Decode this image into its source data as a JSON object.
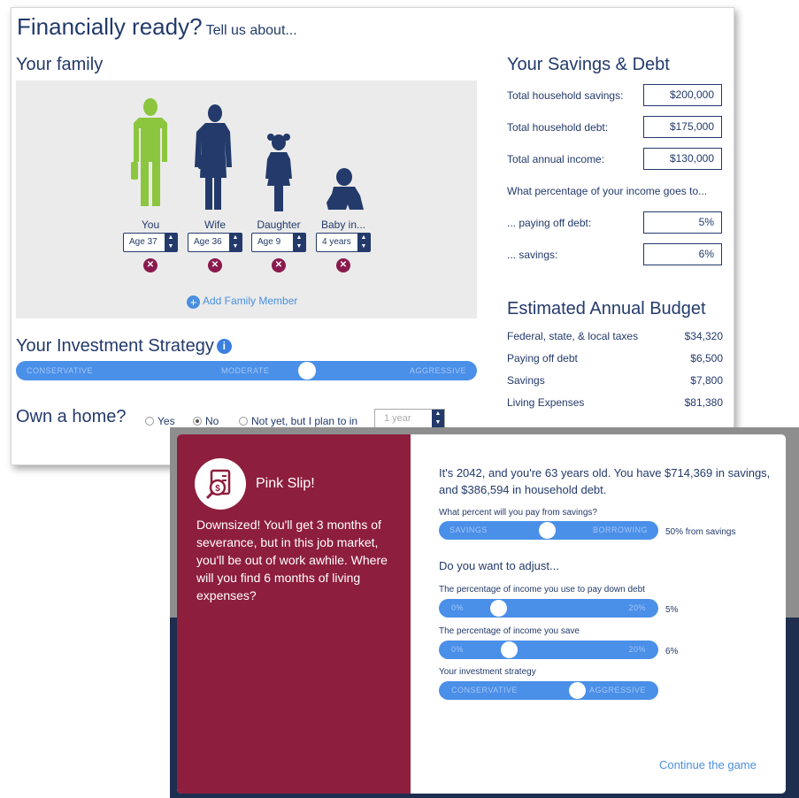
{
  "header": {
    "title": "Financially ready?",
    "subtitle": "Tell us about..."
  },
  "family": {
    "heading": "Your family",
    "members": [
      {
        "name": "You",
        "age": "Age 37",
        "color": "#8cc63f"
      },
      {
        "name": "Wife",
        "age": "Age 36",
        "color": "#233a6b"
      },
      {
        "name": "Daughter",
        "age": "Age 9",
        "color": "#233a6b"
      },
      {
        "name": "Baby in...",
        "age": "4 years",
        "color": "#233a6b"
      }
    ],
    "add_label": "Add Family Member"
  },
  "strategy": {
    "heading": "Your Investment Strategy",
    "labels": [
      "CONSERVATIVE",
      "MODERATE",
      "AGGRESSIVE"
    ],
    "level": 0.64
  },
  "home": {
    "question": "Own a home?",
    "options": [
      "Yes",
      "No",
      "Not yet, but I plan to in"
    ],
    "selected": "No",
    "plan_value": "1 year"
  },
  "savings_debt": {
    "heading": "Your Savings & Debt",
    "rows": [
      {
        "label": "Total household savings:",
        "value": "$200,000"
      },
      {
        "label": "Total household debt:",
        "value": "$175,000"
      },
      {
        "label": "Total annual income:",
        "value": "$130,000"
      }
    ],
    "percent_question": "What percentage of your income goes to...",
    "percent_rows": [
      {
        "label": "... paying off debt:",
        "value": "5%"
      },
      {
        "label": "... savings:",
        "value": "6%"
      }
    ]
  },
  "budget": {
    "heading": "Estimated Annual Budget",
    "rows": [
      {
        "label": "Federal, state, & local taxes",
        "value": "$34,320"
      },
      {
        "label": "Paying off debt",
        "value": "$6,500"
      },
      {
        "label": "Savings",
        "value": "$7,800"
      },
      {
        "label": "Living Expenses",
        "value": "$81,380"
      }
    ]
  },
  "modal": {
    "title": "Pink Slip!",
    "icon": "pink-slip-icon",
    "message": "Downsized! You'll get 3 months of severance, but in this job market, you'll be out of work awhile. Where will you find 6 months of living expenses?",
    "summary": "It's 2042, and you're 63 years old. You have $714,369 in savings, and $386,594 in household debt.",
    "pay_question": "What percent will you pay from savings?",
    "pay_slider": {
      "left": "SAVINGS",
      "right": "BORROWING",
      "value": "50% from savings",
      "level": 0.5
    },
    "adjust_heading": "Do you want to adjust...",
    "debt_label": "The percentage of income you use to pay down debt",
    "debt_slider": {
      "left": "0%",
      "right": "20%",
      "value": "5%",
      "level": 0.25
    },
    "save_label": "The percentage of income you save",
    "save_slider": {
      "left": "0%",
      "right": "20%",
      "value": "6%",
      "level": 0.3
    },
    "strategy_label": "Your investment strategy",
    "strategy_slider": {
      "left": "CONSERVATIVE",
      "right": "AGGRESSIVE",
      "level": 0.65
    },
    "continue_label": "Continue the game"
  }
}
